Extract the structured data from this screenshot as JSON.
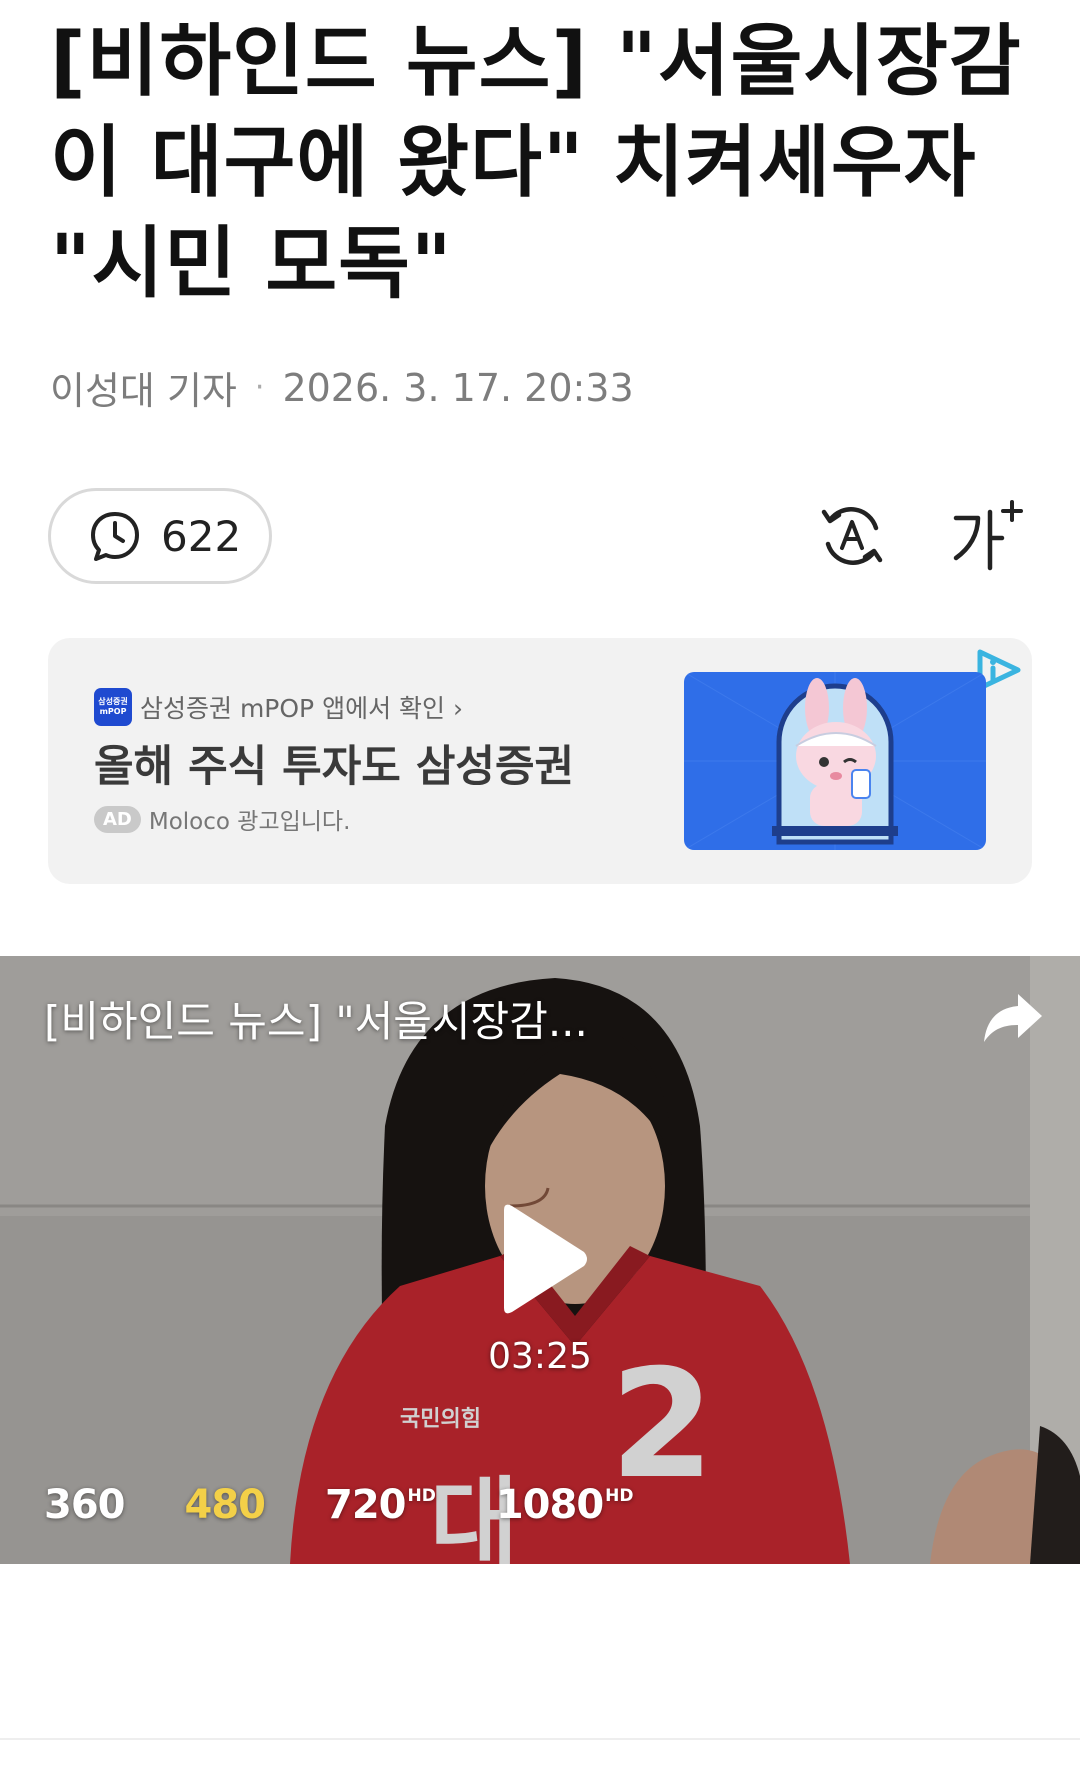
{
  "article": {
    "title": "[비하인드 뉴스] \"서울시장감이 대구에 왔다\" 치켜세우자 \"시민 모독\"",
    "author": "이성대 기자",
    "separator": "·",
    "datetime": "2026. 3. 17. 20:33"
  },
  "toolbar": {
    "comment_count": "622",
    "comment_icon": "speech-bubble-clock-icon",
    "translate_icon": "translate-icon",
    "font_size_icon": "font-size-icon"
  },
  "ad": {
    "app_logo_text_top": "삼성증권",
    "app_logo_text_bottom": "mPOP",
    "app_link": "삼성증권 mPOP 앱에서 확인 ›",
    "headline": "올해 주식 투자도 삼성증권",
    "badge": "AD",
    "label": "Moloco 광고입니다.",
    "adchoices_icon": "adchoices-icon"
  },
  "video": {
    "title": "[비하인드 뉴스] \"서울시장감...",
    "duration": "03:25",
    "qualities": [
      {
        "label": "360",
        "hd": ""
      },
      {
        "label": "480",
        "hd": ""
      },
      {
        "label": "720",
        "hd": "HD"
      },
      {
        "label": "1080",
        "hd": "HD"
      }
    ],
    "selected_quality": "480",
    "share_icon": "share-arrow-icon",
    "play_icon": "play-icon",
    "frame_text": {
      "jacket_number": "2",
      "party_logo": "국민의힘",
      "jacket_name": "대"
    }
  },
  "colors": {
    "selected_quality": "#f3d048",
    "ad_background": "#f2f2f2",
    "ad_image": "#2f6ee8",
    "jacket_red": "#cf2a33"
  }
}
